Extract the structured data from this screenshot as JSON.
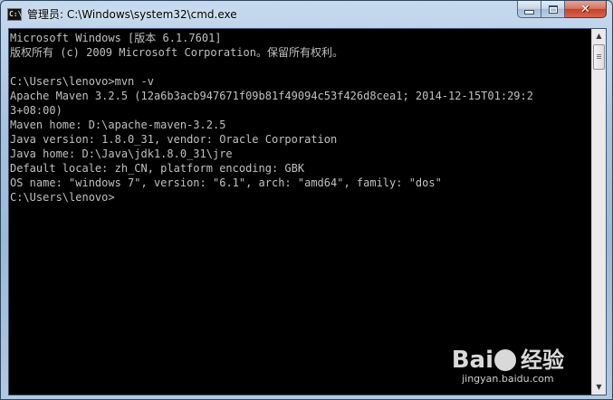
{
  "window": {
    "title": "管理员: C:\\Windows\\system32\\cmd.exe",
    "app_icon_text": "C:\\"
  },
  "caption_buttons": {
    "minimize": "—",
    "maximize": "□",
    "close": "✕"
  },
  "console": {
    "lines": [
      "Microsoft Windows [版本 6.1.7601]",
      "版权所有 (c) 2009 Microsoft Corporation。保留所有权利。",
      "",
      "C:\\Users\\lenovo>mvn -v",
      "Apache Maven 3.2.5 (12a6b3acb947671f09b81f49094c53f426d8cea1; 2014-12-15T01:29:2",
      "3+08:00)",
      "Maven home: D:\\apache-maven-3.2.5",
      "Java version: 1.8.0_31, vendor: Oracle Corporation",
      "Java home: D:\\Java\\jdk1.8.0_31\\jre",
      "Default locale: zh_CN, platform encoding: GBK",
      "OS name: \"windows 7\", version: \"6.1\", arch: \"amd64\", family: \"dos\"",
      "C:\\Users\\lenovo>"
    ],
    "fg_color": "#c0c0c0",
    "bg_color": "#000000"
  },
  "scrollbar": {
    "up_arrow": "▲",
    "down_arrow": "▼"
  },
  "watermark": {
    "brand_left": "Bai",
    "brand_right": "经验",
    "url": "jingyan.baidu.com"
  }
}
